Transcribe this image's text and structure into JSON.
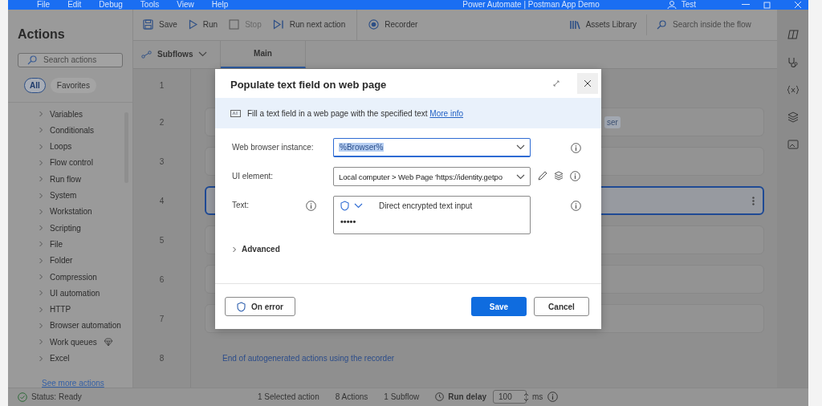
{
  "title_bar": {
    "menu": [
      "File",
      "Edit",
      "Debug",
      "Tools",
      "View",
      "Help"
    ],
    "title": "Power Automate | Postman App Demo",
    "user": "Test"
  },
  "actions_panel": {
    "title": "Actions",
    "search": {
      "placeholder": "Search actions"
    },
    "filters": [
      {
        "label": "All",
        "selected": true
      },
      {
        "label": "Favorites",
        "selected": false
      }
    ],
    "groups": [
      {
        "label": "Variables",
        "premium": false
      },
      {
        "label": "Conditionals",
        "premium": false
      },
      {
        "label": "Loops",
        "premium": false
      },
      {
        "label": "Flow control",
        "premium": false
      },
      {
        "label": "Run flow",
        "premium": false
      },
      {
        "label": "System",
        "premium": false
      },
      {
        "label": "Workstation",
        "premium": false
      },
      {
        "label": "Scripting",
        "premium": false
      },
      {
        "label": "File",
        "premium": false
      },
      {
        "label": "Folder",
        "premium": false
      },
      {
        "label": "Compression",
        "premium": false
      },
      {
        "label": "UI automation",
        "premium": false
      },
      {
        "label": "HTTP",
        "premium": false
      },
      {
        "label": "Browser automation",
        "premium": false
      },
      {
        "label": "Work queues",
        "premium": true
      },
      {
        "label": "Excel",
        "premium": false
      }
    ],
    "see_more": "See more actions"
  },
  "toolbar": {
    "buttons": [
      {
        "label": "Save",
        "kind": "save",
        "disabled": false
      },
      {
        "label": "Run",
        "kind": "run",
        "disabled": false
      },
      {
        "label": "Stop",
        "kind": "stop",
        "disabled": true
      },
      {
        "label": "Run next action",
        "kind": "next",
        "disabled": false
      },
      {
        "label": "Recorder",
        "kind": "recorder",
        "disabled": false
      }
    ],
    "assets": "Assets Library",
    "search": {
      "placeholder": "Search inside the flow"
    }
  },
  "subflows": {
    "label": "Subflows",
    "tabs": [
      {
        "label": "Main",
        "selected": true
      }
    ]
  },
  "steps": [
    {
      "number": "1",
      "kind": "blank"
    },
    {
      "number": "2",
      "kind": "card",
      "selected": false,
      "badge": "ser"
    },
    {
      "number": "3",
      "kind": "card",
      "selected": false
    },
    {
      "number": "4",
      "kind": "card",
      "selected": true
    },
    {
      "number": "5",
      "kind": "card",
      "selected": false
    },
    {
      "number": "6",
      "kind": "card",
      "selected": false
    },
    {
      "number": "7",
      "kind": "card",
      "selected": false
    },
    {
      "number": "8",
      "kind": "link",
      "text": "End of autogenerated actions using the recorder"
    }
  ],
  "dialog": {
    "title": "Populate text field on web page",
    "description": "Fill a text field in a web page with the specified text",
    "more_info": "More info",
    "fields": [
      {
        "label": "Web browser instance:",
        "kind": "dropdown",
        "value": "%Browser%",
        "focused": true
      },
      {
        "label": "UI element:",
        "kind": "picker",
        "value": "Local computer > Web Page 'https://identity.getpo",
        "focused": false
      },
      {
        "label": "Text:",
        "kind": "encrypted",
        "mode": "Direct encrypted text input",
        "value": "•••••",
        "focused": false
      }
    ],
    "advanced": {
      "label": "Advanced",
      "expanded": false
    },
    "on_error": "On error",
    "save": "Save",
    "cancel": "Cancel"
  },
  "status_bar": {
    "status": "Status: Ready",
    "selected": "1 Selected action",
    "actions": "8 Actions",
    "subflows": "1 Subflow",
    "run_delay_label": "Run delay",
    "run_delay": "100",
    "unit": "ms"
  }
}
